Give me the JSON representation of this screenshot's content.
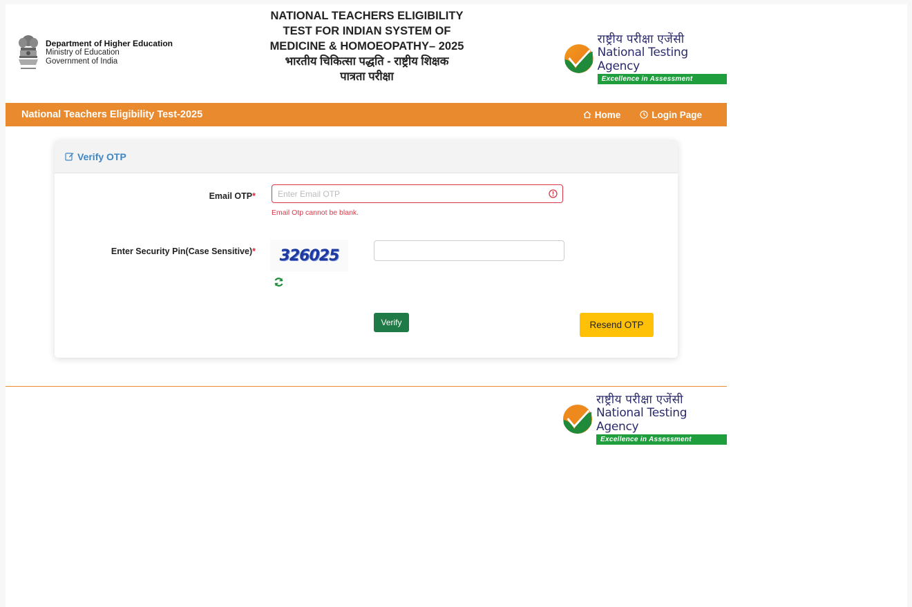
{
  "header": {
    "dept": {
      "title": "Department of Higher Education",
      "line1": "Ministry of Education",
      "line2": "Government of India"
    },
    "exam_title": {
      "line1": "NATIONAL TEACHERS ELIGIBILITY",
      "line2": "TEST FOR INDIAN SYSTEM OF",
      "line3": "MEDICINE & HOMOEOPATHY– 2025",
      "line4": "भारतीय चिकित्सा पद्धति - राष्ट्रीय शिक्षक",
      "line5": "पात्रता परीक्षा"
    },
    "nta": {
      "hindi": "राष्ट्रीय परीक्षा एजेंसी",
      "english": "National Testing Agency",
      "tagline": "Excellence in Assessment"
    }
  },
  "navbar": {
    "brand": "National Teachers Eligibility Test-2025",
    "home": "Home",
    "login": "Login Page",
    "home_icon": "home-icon",
    "login_icon": "clock-icon"
  },
  "card": {
    "title": "Verify OTP",
    "title_icon": "edit-icon",
    "email_otp_label": "Email OTP",
    "email_otp_placeholder": "Enter Email OTP",
    "email_otp_value": "",
    "email_otp_error": "Email Otp cannot be blank.",
    "error_icon": "exclamation-circle-icon",
    "security_pin_label": "Enter Security Pin(Case Sensitive)",
    "captcha": "326025",
    "refresh_icon": "refresh-icon",
    "security_pin_value": "",
    "required_mark": "*",
    "verify_button": "Verify",
    "resend_button": "Resend OTP"
  },
  "footer": {
    "nta": {
      "hindi": "राष्ट्रीय परीक्षा एजेंसी",
      "english": "National Testing Agency",
      "tagline": "Excellence in Assessment"
    }
  },
  "colors": {
    "navbar_bg": "#ea8a2e",
    "card_title": "#3d86c6",
    "error": "#dc3545",
    "verify_bg": "#1e7b47",
    "resend_bg": "#ffc107",
    "nta_green": "#1e9e3c"
  }
}
